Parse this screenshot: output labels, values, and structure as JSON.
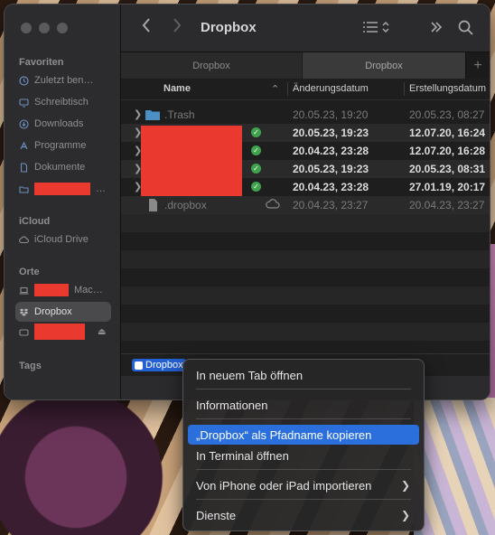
{
  "colors": {
    "accent": "#2a6fdb",
    "redaction": "#ea3a2f",
    "sync_ok": "#3fa34d",
    "folder": "#4a90c4"
  },
  "window": {
    "title": "Dropbox"
  },
  "toolbar": {
    "back_icon": "chevron-left-icon",
    "forward_icon": "chevron-right-icon",
    "view_icon": "list-view-icon",
    "more_icon": "double-chevron-right-icon",
    "search_icon": "search-icon"
  },
  "tabs": [
    {
      "label": "Dropbox"
    },
    {
      "label": "Dropbox"
    }
  ],
  "sidebar": {
    "favorites_title": "Favoriten",
    "favorites": [
      {
        "label": "Zuletzt ben…",
        "icon": "clock-icon"
      },
      {
        "label": "Schreibtisch",
        "icon": "desktop-icon"
      },
      {
        "label": "Downloads",
        "icon": "download-icon"
      },
      {
        "label": "Programme",
        "icon": "apps-icon"
      },
      {
        "label": "Dokumente",
        "icon": "document-icon"
      },
      {
        "label": "…",
        "icon": "folder-icon"
      }
    ],
    "icloud_title": "iCloud",
    "icloud": [
      {
        "label": "iCloud Drive",
        "icon": "cloud-icon"
      }
    ],
    "locations_title": "Orte",
    "locations": [
      {
        "label": "Mac…",
        "icon": "laptop-icon"
      },
      {
        "label": "Dropbox",
        "icon": "dropbox-icon"
      },
      {
        "label": "",
        "icon": "drive-icon"
      }
    ],
    "tags_title": "Tags"
  },
  "columns": {
    "name": "Name",
    "modified": "Änderungsdatum",
    "created": "Erstellungsdatum"
  },
  "files": [
    {
      "name": ".Trash",
      "modified": "20.05.23, 19:20",
      "created": "20.05.23, 08:27",
      "dim": true,
      "expandable": true,
      "icon": "folder-icon"
    },
    {
      "name": "",
      "modified": "20.05.23, 19:23",
      "created": "12.07.20, 16:24",
      "expandable": true,
      "synced": true
    },
    {
      "name": "",
      "modified": "20.04.23, 23:28",
      "created": "12.07.20, 16:28",
      "expandable": true,
      "synced": true
    },
    {
      "name": "",
      "modified": "20.05.23, 19:23",
      "created": "20.05.23, 08:31",
      "expandable": true,
      "synced": true
    },
    {
      "name": "",
      "modified": "20.04.23, 23:28",
      "created": "27.01.19, 20:17",
      "expandable": true,
      "synced": true
    },
    {
      "name": ".dropbox",
      "modified": "20.04.23, 23:27",
      "created": "20.04.23, 23:27",
      "dim": true,
      "icon": "file-icon",
      "cloud": true
    }
  ],
  "pathbar": {
    "label": "Dropbox"
  },
  "context_menu": {
    "items": [
      {
        "label": "In neuem Tab öffnen"
      },
      {
        "label": "Informationen"
      },
      {
        "label": "„Dropbox“ als Pfadname kopieren",
        "highlighted": true
      },
      {
        "label": "In Terminal öffnen"
      },
      {
        "label": "Von iPhone oder iPad importieren",
        "submenu": true
      },
      {
        "label": "Dienste",
        "submenu": true
      }
    ]
  }
}
